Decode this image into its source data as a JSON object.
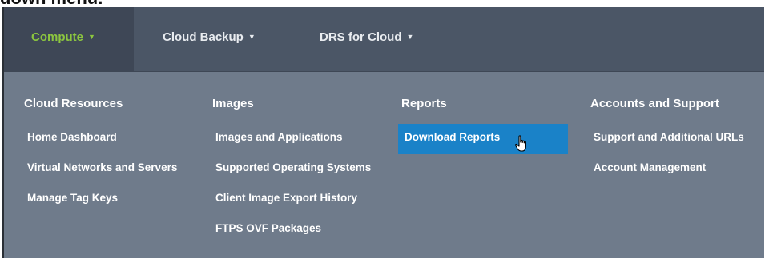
{
  "caption": "down menu.",
  "nav": {
    "items": [
      {
        "label": "Compute",
        "active": true
      },
      {
        "label": "Cloud Backup",
        "active": false
      },
      {
        "label": "DRS for Cloud",
        "active": false
      }
    ]
  },
  "menu": {
    "columns": [
      {
        "heading": "Cloud Resources",
        "items": [
          "Home Dashboard",
          "Virtual Networks and Servers",
          "Manage Tag Keys"
        ]
      },
      {
        "heading": "Images",
        "items": [
          "Images and Applications",
          "Supported Operating Systems",
          "Client Image Export History",
          "FTPS OVF Packages"
        ]
      },
      {
        "heading": "Reports",
        "items": [
          "Download Reports"
        ]
      },
      {
        "heading": "Accounts and Support",
        "items": [
          "Support and Additional URLs",
          "Account Management"
        ]
      }
    ]
  },
  "colors": {
    "nav_bg": "#4b5666",
    "panel_bg": "#6f7b8b",
    "active_text": "#8cc63f",
    "highlight": "#1a82c8"
  },
  "icons": {
    "caret": "caret-down-icon",
    "cursor": "hand-pointer-icon"
  }
}
